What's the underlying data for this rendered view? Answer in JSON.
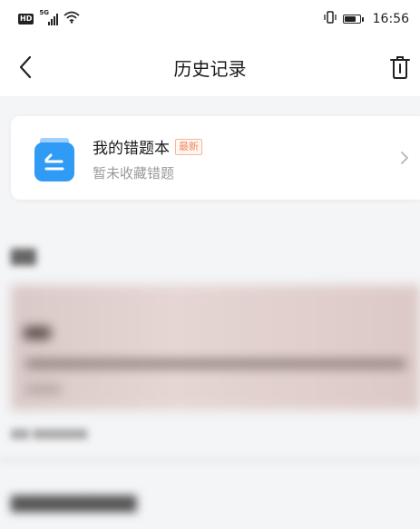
{
  "status_bar": {
    "hd_badge": "HD",
    "network": "5G",
    "time": "16:56",
    "battery_level": 0.8,
    "icons": [
      "hd-icon",
      "signal-icon",
      "wifi-icon",
      "vibrate-icon",
      "battery-icon"
    ]
  },
  "nav": {
    "title": "历史记录",
    "back_icon": "chevron-left-icon",
    "trash_icon": "trash-icon"
  },
  "card": {
    "title": "我的错题本",
    "badge": "最新",
    "subtitle": "暂未收藏错题",
    "icon": "notebook-icon",
    "accent_color": "#2f9bf5"
  },
  "colors": {
    "page_bg": "#f4f5f7",
    "tag_color": "#f08a5d",
    "muted_text": "#9a9a9a"
  }
}
